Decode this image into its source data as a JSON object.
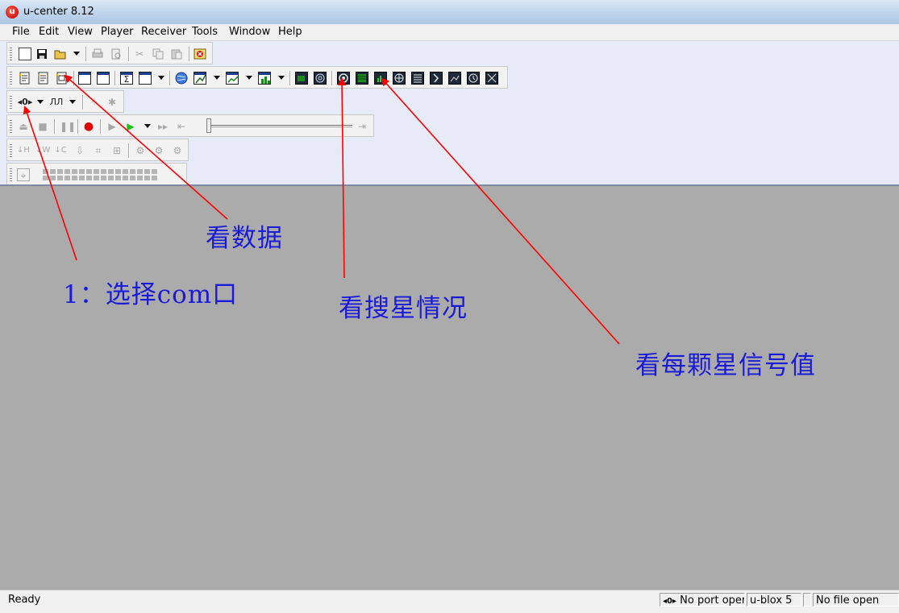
{
  "window": {
    "title": "u-center 8.12",
    "logo_glyph": "u"
  },
  "menu": [
    "File",
    "Edit",
    "View",
    "Player",
    "Receiver",
    "Tools",
    "Window",
    "Help"
  ],
  "annotations": {
    "select_com": "1：选择com口",
    "view_data": "看数据",
    "view_satellites": "看搜星情况",
    "view_signal": "看每颗星信号值",
    "color": "#1a1ad8",
    "arrow_color": "#ff0000"
  },
  "statusbar": {
    "ready": "Ready",
    "port_icon": "port-icon",
    "port_status": "No port open",
    "receiver_type": "u-blox 5",
    "file_status": "No file open"
  }
}
